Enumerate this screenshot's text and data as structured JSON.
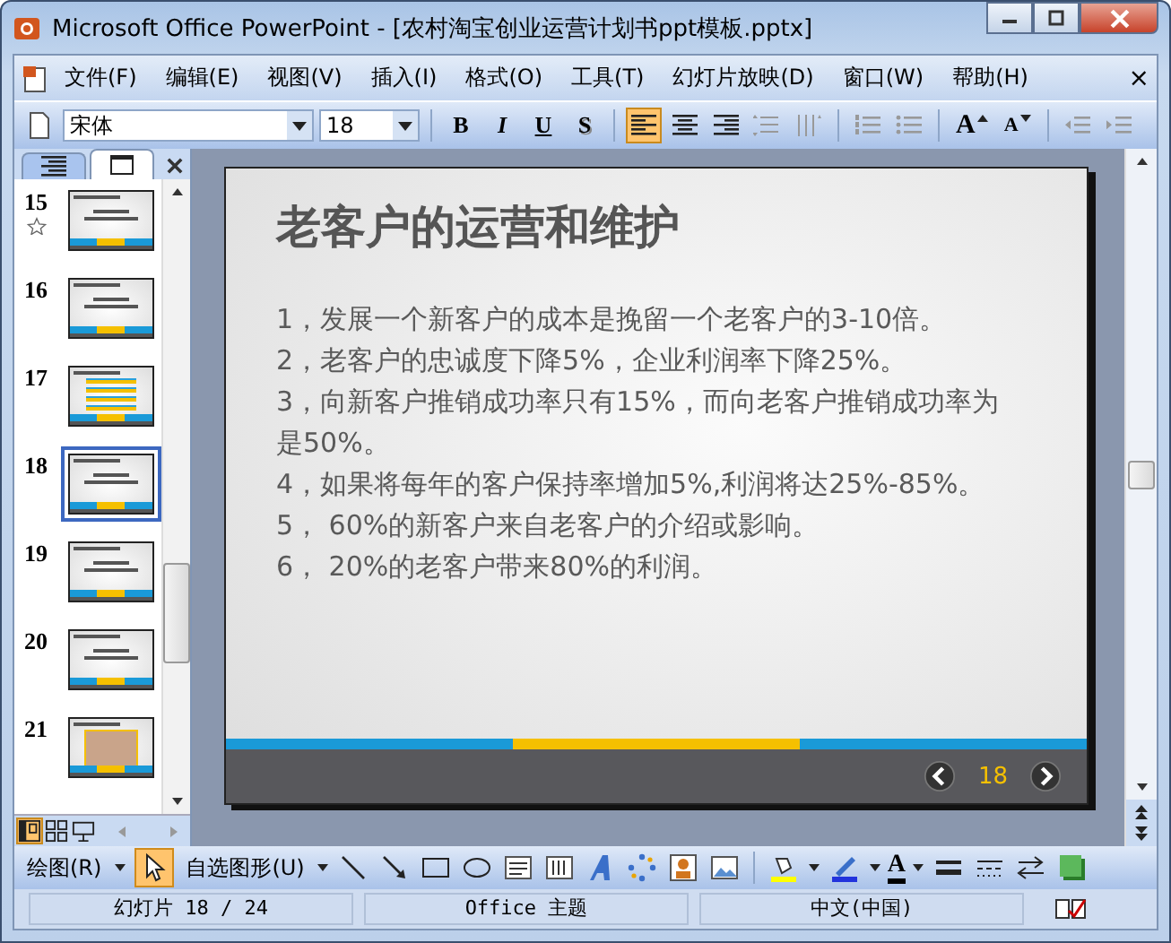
{
  "window": {
    "title": "Microsoft Office PowerPoint - [农村淘宝创业运营计划书ppt模板.pptx]"
  },
  "menu": [
    "文件(F)",
    "编辑(E)",
    "视图(V)",
    "插入(I)",
    "格式(O)",
    "工具(T)",
    "幻灯片放映(D)",
    "窗口(W)",
    "帮助(H)"
  ],
  "menu_close": "×",
  "toolbar": {
    "font": "宋体",
    "size": "18",
    "format_buttons": [
      {
        "label": "B",
        "kind": "bold"
      },
      {
        "label": "I",
        "kind": "italic"
      },
      {
        "label": "U",
        "kind": "underline"
      },
      {
        "label": "S",
        "kind": "shadow"
      }
    ],
    "align_buttons": [
      {
        "kind": "left",
        "selected": true
      },
      {
        "kind": "center",
        "selected": false
      },
      {
        "kind": "right",
        "selected": false
      }
    ],
    "size_buttons": [
      {
        "label": "A",
        "kind": "grow"
      },
      {
        "label": "A",
        "kind": "shrink"
      }
    ]
  },
  "pane_tabs": [
    {
      "kind": "outline",
      "selected": false
    },
    {
      "kind": "slides",
      "selected": true
    }
  ],
  "thumbnails": [
    {
      "number": "15",
      "selected": false,
      "animated": true,
      "kind": "text"
    },
    {
      "number": "16",
      "selected": false,
      "animated": false,
      "kind": "text"
    },
    {
      "number": "17",
      "selected": false,
      "animated": false,
      "kind": "bars"
    },
    {
      "number": "18",
      "selected": true,
      "animated": false,
      "kind": "text"
    },
    {
      "number": "19",
      "selected": false,
      "animated": false,
      "kind": "text"
    },
    {
      "number": "20",
      "selected": false,
      "animated": false,
      "kind": "text"
    },
    {
      "number": "21",
      "selected": false,
      "animated": false,
      "kind": "photo"
    }
  ],
  "slide": {
    "title": "老客户的运营和维护",
    "bullets": [
      "1，发展一个新客户的成本是挽留一个老客户的3-10倍。",
      "2，老客户的忠诚度下降5%，企业利润率下降25%。",
      "3，向新客户推销成功率只有15%，而向老客户推销成功率为是50%。",
      "4，如果将每年的客户保持率增加5%,利润将达25%-85%。",
      "5， 60%的新客户来自老客户的介绍或影响。",
      "6， 20%的老客户带来80%的利润。"
    ],
    "page_number": "18"
  },
  "drawing_toolbar": {
    "draw_menu": "绘图(R)",
    "autoshapes_menu": "自选图形(U)",
    "font_color_glyph": "A"
  },
  "status_bar": [
    "幻灯片 18 / 24",
    "Office 主题",
    "中文(中国)"
  ]
}
